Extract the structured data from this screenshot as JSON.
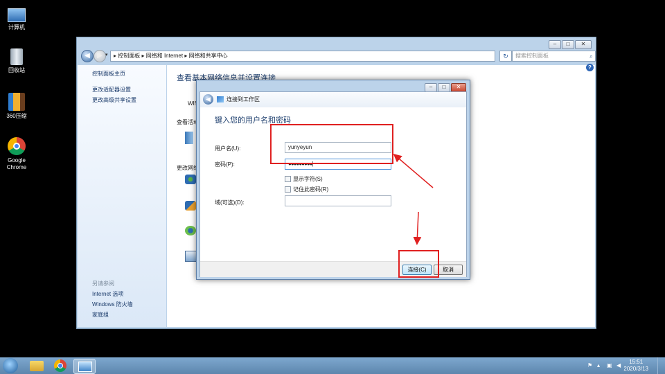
{
  "desktop": {
    "icons": [
      {
        "label": "计算机"
      },
      {
        "label": "回收站"
      },
      {
        "label": "360压缩"
      },
      {
        "label_line1": "Google",
        "label_line2": "Chrome"
      }
    ]
  },
  "window": {
    "breadcrumb": {
      "sep": "▸",
      "items": [
        "控制面板",
        "网络和 Internet",
        "网络和共享中心"
      ]
    },
    "search_placeholder": "搜索控制面板",
    "sidebar": {
      "links": [
        "控制面板主页",
        "更改适配器设置",
        "更改高级共享设置"
      ],
      "see_also_header": "另请参阅",
      "see_also": [
        "Internet 选项",
        "Windows 防火墙",
        "家庭组"
      ]
    },
    "content": {
      "title": "查看基本网络信息并设置连接",
      "fragments": [
        "WIN",
        "查看活动",
        "更改网络"
      ]
    }
  },
  "dialog": {
    "title": "连接到工作区",
    "prompt": "键入您的用户名和密码",
    "username_label": "用户名(U):",
    "username_value": "yunyeyun",
    "password_label": "密码(P):",
    "password_value": "●●●●●●●●●",
    "show_chars_label": "显示字符(S)",
    "remember_label": "记住此密码(R)",
    "domain_label": "域(可选)(D):",
    "domain_value": "",
    "connect_label": "连接(C)",
    "cancel_label": "取消"
  },
  "taskbar": {
    "time": "15:51",
    "date": "2020/3/13",
    "icons": [
      "windows-start-icon",
      "file-explorer-icon",
      "chrome-icon",
      "network-control-panel-icon"
    ]
  },
  "colors": {
    "annotation_red": "#e02020",
    "window_frame": "#bcd3ea",
    "link_blue": "#1a3a6a",
    "heading_blue": "#1e3f6e"
  }
}
